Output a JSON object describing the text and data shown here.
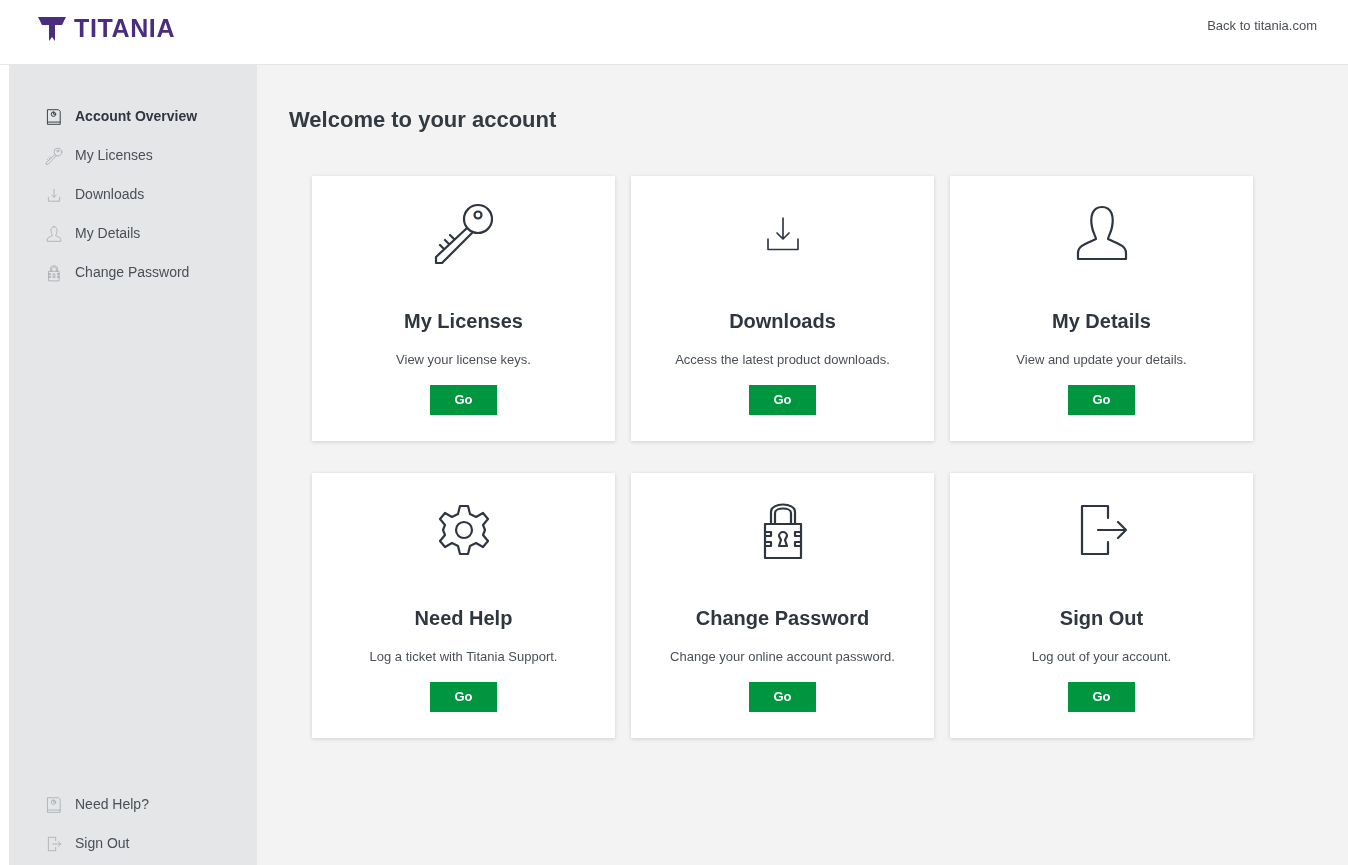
{
  "header": {
    "logo": "TITANIA",
    "link": "Back to titania.com"
  },
  "sidebar": {
    "items": [
      {
        "label": "Account Overview",
        "kind": "book",
        "selected": true
      },
      {
        "label": "My Licenses",
        "kind": "key",
        "selected": false
      },
      {
        "label": "Downloads",
        "kind": "download",
        "selected": false
      },
      {
        "label": "My Details",
        "kind": "user",
        "selected": false
      },
      {
        "label": "Change Password",
        "kind": "lock",
        "selected": false
      }
    ],
    "bottom_items": [
      {
        "label": "Need Help?",
        "kind": "book",
        "selected": false
      },
      {
        "label": "Sign Out",
        "kind": "signout",
        "selected": false
      }
    ]
  },
  "main": {
    "title": "Welcome to your account",
    "cards": [
      {
        "kind": "key",
        "title": "My Licenses",
        "text": "View your license keys.",
        "button": "Go"
      },
      {
        "kind": "download",
        "title": "Downloads",
        "text": "Access the latest product downloads.",
        "button": "Go"
      },
      {
        "kind": "user",
        "title": "My Details",
        "text": "View and update your details.",
        "button": "Go"
      },
      {
        "kind": "gear",
        "title": "Need Help",
        "text": "Log a ticket with Titania Support.",
        "button": "Go"
      },
      {
        "kind": "lock",
        "title": "Change Password",
        "text": "Change your online account password.",
        "button": "Go"
      },
      {
        "kind": "signout",
        "title": "Sign Out",
        "text": "Log out of your account.",
        "button": "Go"
      }
    ]
  }
}
